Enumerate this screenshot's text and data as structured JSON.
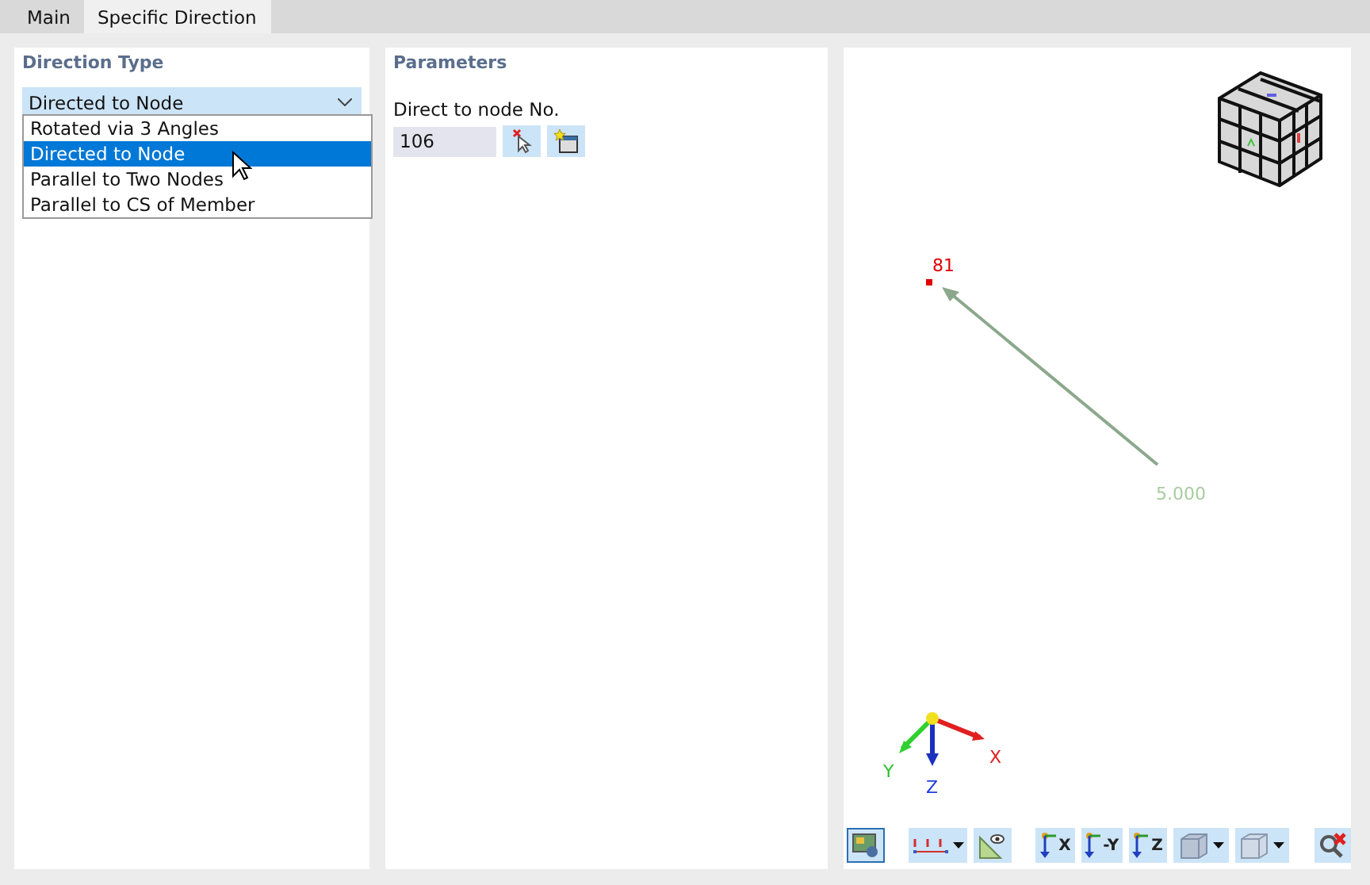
{
  "tabs": [
    {
      "label": "Main",
      "selected": false
    },
    {
      "label": "Specific Direction",
      "selected": true
    }
  ],
  "direction_type": {
    "title": "Direction Type",
    "value": "Directed to Node",
    "expanded": true,
    "options": [
      {
        "label": "Rotated via 3 Angles",
        "selected": false
      },
      {
        "label": "Directed to Node",
        "selected": true
      },
      {
        "label": "Parallel to Two Nodes",
        "selected": false
      },
      {
        "label": "Parallel to CS of Member",
        "selected": false
      }
    ]
  },
  "parameters": {
    "title": "Parameters",
    "field_label": "Direct to node No.",
    "value": "106"
  },
  "viewport": {
    "node_label": "81",
    "length_label": "5.000",
    "axes": {
      "x": "X",
      "y": "Y",
      "z": "Z"
    },
    "toolbar": [
      {
        "kind": "display",
        "selected": true
      },
      {
        "kind": "numbering",
        "dropdown": true
      },
      {
        "kind": "ruler"
      },
      {
        "kind": "view",
        "label": "X"
      },
      {
        "kind": "view",
        "label": "-Y"
      },
      {
        "kind": "view",
        "label": "Z"
      },
      {
        "kind": "solid",
        "dropdown": true
      },
      {
        "kind": "box",
        "dropdown": true
      },
      {
        "kind": "reset"
      }
    ]
  }
}
